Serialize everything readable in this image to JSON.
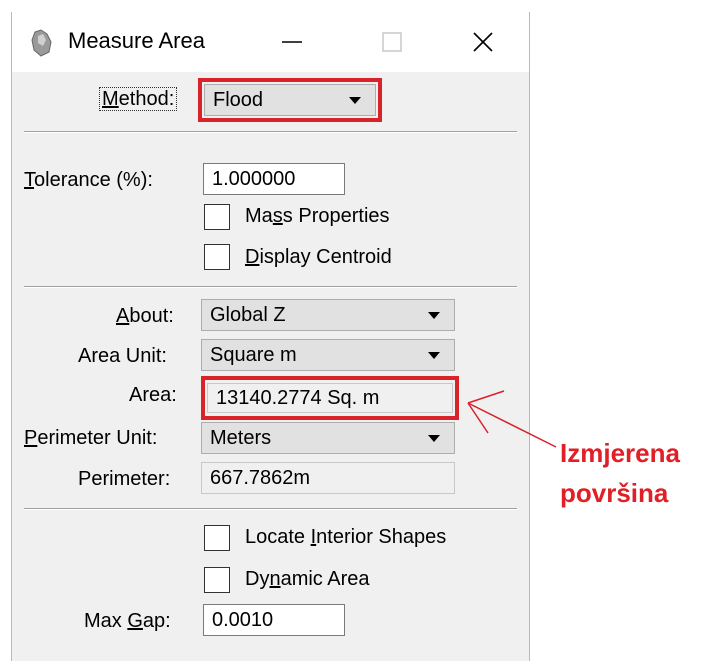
{
  "window": {
    "title": "Measure Area",
    "icon": "measure-tool-icon",
    "controls": {
      "minimize": "—",
      "maximize": "☐",
      "close": "✕"
    }
  },
  "method": {
    "label": "Method:",
    "value": "Flood"
  },
  "tolerance": {
    "label": "Tolerance (%):",
    "value": "1.000000"
  },
  "mass_properties": {
    "label": "Mass Properties",
    "checked": false
  },
  "display_centroid": {
    "label": "Display Centroid",
    "checked": false
  },
  "about": {
    "label": "About:",
    "value": "Global Z"
  },
  "area_unit": {
    "label": "Area Unit:",
    "value": "Square m"
  },
  "area": {
    "label": "Area:",
    "value": "13140.2774 Sq. m"
  },
  "perimeter_unit": {
    "label": "Perimeter Unit:",
    "value": "Meters"
  },
  "perimeter": {
    "label": "Perimeter:",
    "value": "667.7862m"
  },
  "locate_interior": {
    "label": "Locate Interior Shapes",
    "checked": false
  },
  "dynamic_area": {
    "label": "Dynamic Area",
    "checked": false
  },
  "max_gap": {
    "label": "Max Gap:",
    "value": "0.0010"
  },
  "annotation": {
    "line1": "Izmjerena",
    "line2": "površina",
    "color": "#e01f26"
  },
  "colors": {
    "highlight": "#d8232a",
    "dialog_bg": "#f0f0f0"
  }
}
